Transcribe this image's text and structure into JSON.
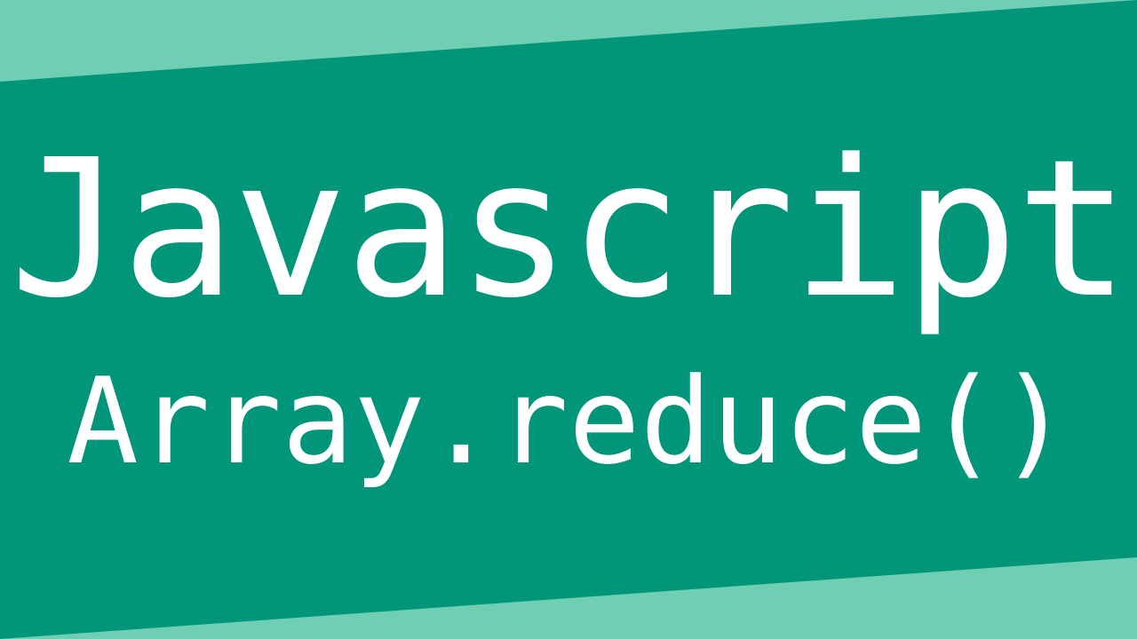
{
  "colors": {
    "background_light": "#70ceb2",
    "band_green": "#019579",
    "text": "#ffffff"
  },
  "thumbnail": {
    "title": "Javascript",
    "subtitle": "Array.reduce()"
  }
}
